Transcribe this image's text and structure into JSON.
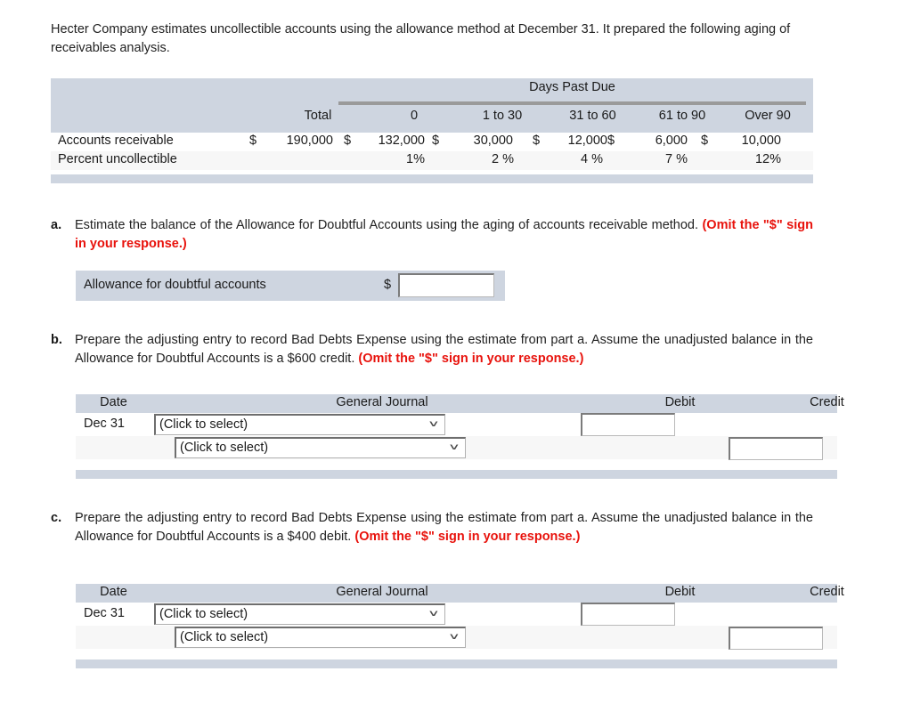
{
  "intro": "Hecter Company estimates uncollectible accounts using the allowance method at December 31. It prepared the following aging of receivables analysis.",
  "aging_table": {
    "group_header": "Days Past Due",
    "column_headers": [
      "Total",
      "0",
      "1 to 30",
      "31 to 60",
      "61 to 90",
      "Over 90"
    ],
    "rows": [
      {
        "label": "Accounts receivable",
        "currency_symbol": "$",
        "values": [
          "190,000",
          "132,000",
          "30,000",
          "12,000",
          "6,000",
          "10,000"
        ]
      },
      {
        "label": "Percent uncollectible",
        "values": [
          "",
          "1%",
          "2 %",
          "4 %",
          "7 %",
          "12%"
        ]
      }
    ]
  },
  "part_a": {
    "letter": "a.",
    "text": "Estimate the balance of the Allowance for Doubtful Accounts using the aging of accounts receivable method. ",
    "omit_note": "(Omit the \"$\" sign in your response.)",
    "answer_row": {
      "label": "Allowance for doubtful accounts",
      "currency_symbol": "$",
      "value": "",
      "placeholder": ""
    }
  },
  "part_b": {
    "letter": "b.",
    "text": "Prepare the adjusting entry to record Bad Debts Expense using the estimate from part a. Assume the unadjusted balance in the Allowance for Doubtful Accounts is a $600 credit. ",
    "omit_note": "(Omit the \"$\" sign in your response.)",
    "journal": {
      "headers": [
        "Date",
        "General Journal",
        "Debit",
        "Credit"
      ],
      "rows": [
        {
          "date": "Dec 31",
          "account": "(Click to select)",
          "debit": "",
          "credit": ""
        },
        {
          "date": "",
          "account": "(Click to select)",
          "debit": "",
          "credit": ""
        }
      ]
    }
  },
  "part_c": {
    "letter": "c.",
    "text": "Prepare the adjusting entry to record Bad Debts Expense using the estimate from part a. Assume the unadjusted balance in the Allowance for Doubtful Accounts is a $400 debit. ",
    "omit_note": "(Omit the \"$\" sign in your response.)",
    "journal": {
      "headers": [
        "Date",
        "General Journal",
        "Debit",
        "Credit"
      ],
      "rows": [
        {
          "date": "Dec 31",
          "account": "(Click to select)",
          "debit": "",
          "credit": ""
        },
        {
          "date": "",
          "account": "(Click to select)",
          "debit": "",
          "credit": ""
        }
      ]
    }
  },
  "icons": {
    "dropdown": "chevron-down-icon",
    "chevron_glyph": "∨"
  },
  "colors": {
    "header_band": "#ced5e0",
    "row_alt": "#f7f7f7",
    "rule": "#9a9a9a",
    "omit_red": "#e8120c"
  }
}
